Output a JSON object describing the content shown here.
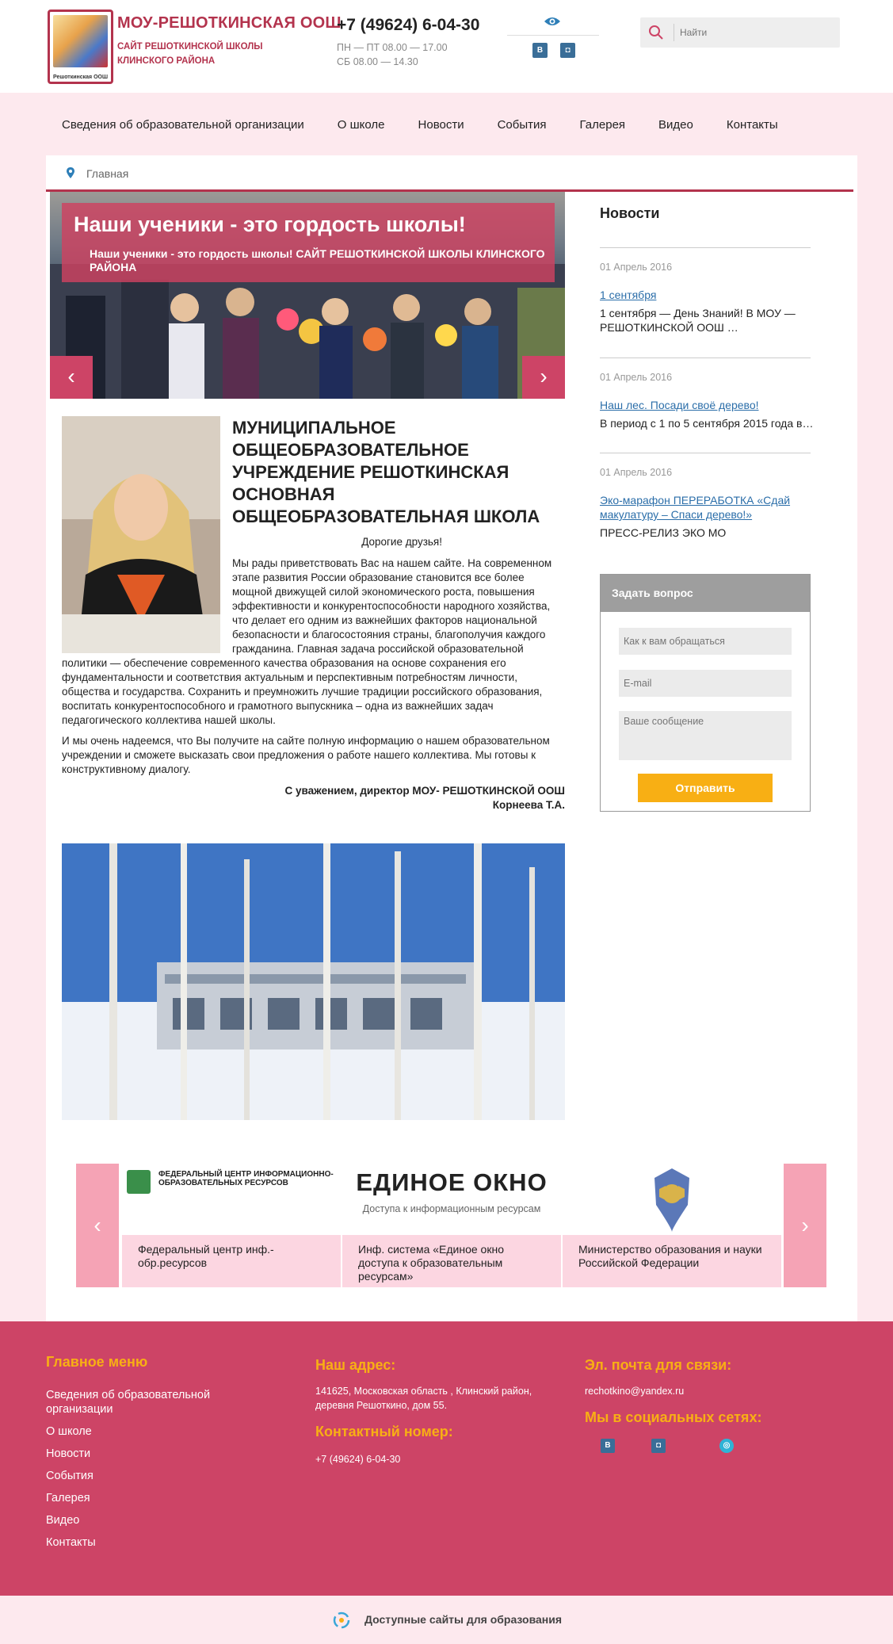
{
  "header": {
    "logo_caption": "Решоткинская ООШ",
    "site_name": "МОУ-РЕШОТКИНСКАЯ ООШ",
    "site_subtitle": "САЙТ РЕШОТКИНСКОЙ ШКОЛЫ КЛИНСКОГО РАЙОНА",
    "phone": "+7 (49624) 6-04-30",
    "hours_weekdays": "ПН — ПТ 08.00 — 17.00",
    "hours_saturday": "СБ 08.00 — 14.30",
    "social_vk": "В",
    "social_ig": "◘",
    "search_placeholder": "Найти"
  },
  "nav": {
    "items": [
      "Сведения об образовательной организации",
      "О школе",
      "Новости",
      "События",
      "Галерея",
      "Видео",
      "Контакты"
    ]
  },
  "breadcrumb": {
    "home": "Главная"
  },
  "slider": {
    "title": "Наши ученики - это гордость школы!",
    "subtitle": "Наши ученики - это гордость школы! САЙТ РЕШОТКИНСКОЙ ШКОЛЫ КЛИНСКОГО РАЙОНА",
    "prev": "‹",
    "next": "›"
  },
  "welcome": {
    "title": "МУНИЦИПАЛЬНОЕ ОБЩЕОБРАЗОВАТЕЛЬНОЕ УЧРЕЖДЕНИЕ РЕШОТКИНСКАЯ ОСНОВНАЯ ОБЩЕОБРАЗОВАТЕЛЬНАЯ ШКОЛА",
    "greeting": "Дорогие друзья!",
    "paragraph1": "Мы рады приветствовать Вас на нашем сайте. На современном этапе развития России образование становится все более мощной движущей силой экономического роста, повышения эффективности и конкурентоспособности народного хозяйства, что делает его одним из важнейших факторов национальной безопасности и благосостояния страны, благополучия каждого гражданина. Главная задача российской образовательной политики — обеспечение современного качества образования на основе сохранения его фундаментальности и соответствия актуальным и перспективным потребностям личности, общества и государства. Сохранить и преумножить лучшие традиции российского образования, воспитать конкурентоспособного и грамотного выпускника – одна из важнейших задач педагогического коллектива нашей школы.",
    "paragraph2": "И мы очень надеемся, что Вы получите на сайте полную информацию о нашем образовательном учреждении и сможете высказать свои предложения о работе нашего коллектива. Мы готовы к конструктивному диалогу.",
    "sign_line1": "С уважением, директор МОУ- РЕШОТКИНСКОЙ ООШ",
    "sign_line2": "Корнеева Т.А."
  },
  "resources": {
    "prev": "‹",
    "next": "›",
    "items": [
      {
        "logo_text": "ФЕДЕРАЛЬНЫЙ ЦЕНТР ИНФОРМАЦИОННО-ОБРАЗОВАТЕЛЬНЫХ РЕСУРСОВ",
        "label": "Федеральный центр инф.-обр.ресурсов"
      },
      {
        "logo_text": "ЕДИНОЕ ОКНО",
        "logo_sub": "Доступа к информационным ресурсам",
        "label": "Инф. система «Единое окно доступа к образовательным ресурсам»"
      },
      {
        "logo_text": "",
        "label": "Министерство образования и науки Российской Федерации"
      }
    ]
  },
  "news": {
    "heading": "Новости",
    "items": [
      {
        "date": "01 Апрель 2016",
        "title": "1 сентября",
        "text": "1 сентября — День Знаний! В МОУ — РЕШОТКИНСКОЙ ООШ …"
      },
      {
        "date": "01 Апрель 2016",
        "title": "Наш лес. Посади своё дерево!",
        "text": "В период с 1 по 5 сентября 2015 года в…"
      },
      {
        "date": "01 Апрель 2016",
        "title": "Эко-марафон ПЕРЕРАБОТКА «Сдай макулатуру – Спаси дерево!»",
        "text": "ПРЕСС-РЕЛИЗ ЭКО МО"
      }
    ]
  },
  "ask": {
    "heading": "Задать вопрос",
    "name_placeholder": "Как к вам обращаться",
    "email_placeholder": "E-mail",
    "message_placeholder": "Ваше сообщение",
    "submit": "Отправить"
  },
  "footer": {
    "menu_heading": "Главное меню",
    "menu_items": [
      "Сведения об образовательной организации",
      "О школе",
      "Новости",
      "События",
      "Галерея",
      "Видео",
      "Контакты"
    ],
    "address_heading": "Наш адрес:",
    "address": "141625, Московская область , Клинский район, деревня Решоткино, дом 55.",
    "phone_heading": "Контактный номер:",
    "phone": "+7 (49624) 6-04-30",
    "email_heading": "Эл. почта для связи:",
    "email": "rechotkino@yandex.ru",
    "social_heading": "Мы в социальных сетях:",
    "social_vk": "В",
    "social_ig": "◘",
    "social_ok": "◎"
  },
  "bottom": {
    "text": "Доступные сайты для образования"
  },
  "colors": {
    "brand": "#b3334d",
    "accent_pink": "#cd4466",
    "page_pink": "#fde9ee",
    "button_orange": "#f8af14",
    "link_blue": "#2b6ea9"
  },
  "icons": [
    "eye-icon",
    "search-icon",
    "location-pin-icon",
    "chevron-left-icon",
    "chevron-right-icon",
    "vk-icon",
    "instagram-icon",
    "odnoklassniki-icon"
  ]
}
